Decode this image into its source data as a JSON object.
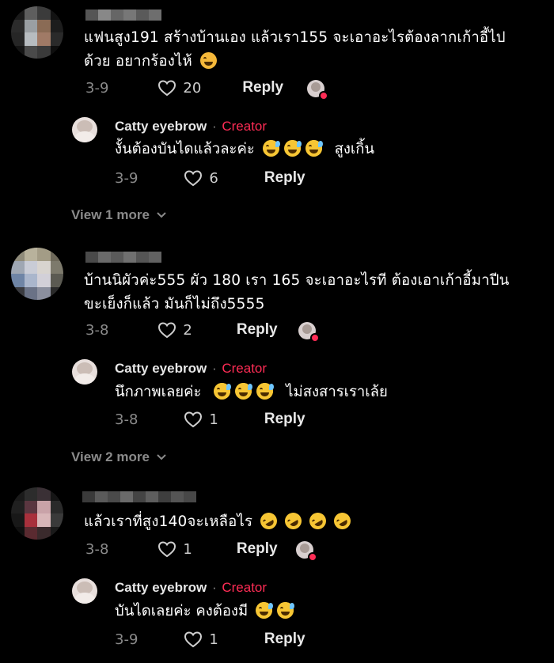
{
  "comments": [
    {
      "text_line1": "แฟนสูง191 สร้างบ้านเอง แล้วเรา155 จะเอาอะไรต้องลากเก้าอี้ไป",
      "text_line2": "ด้วย อยากร้องไห้",
      "date": "3-9",
      "likes": "20",
      "reply_label": "Reply",
      "reply": {
        "author": "Catty eyebrow",
        "separator": "·",
        "badge": "Creator",
        "text": "งั้นต้องบันไดแล้วละค่ะ",
        "text_suffix": "สูงเกิ้น",
        "date": "3-9",
        "likes": "6",
        "reply_label": "Reply"
      },
      "view_more": "View 1 more"
    },
    {
      "text_line1": "บ้านนิผัวค่ะ555 ผัว 180 เรา 165 จะเอาอะไรที ต้องเอาเก้าอี้มาปีน",
      "text_line2": "ขะเย็งก็แล้ว มันก็ไม่ถึง5555",
      "date": "3-8",
      "likes": "2",
      "reply_label": "Reply",
      "reply": {
        "author": "Catty eyebrow",
        "separator": "·",
        "badge": "Creator",
        "text": "นึกภาพเลยค่ะ",
        "text_suffix": "ไม่สงสารเราเล้ย",
        "date": "3-8",
        "likes": "1",
        "reply_label": "Reply"
      },
      "view_more": "View 2 more"
    },
    {
      "text_line1": "แล้วเราที่สูง140จะเหลือไร",
      "date": "3-8",
      "likes": "1",
      "reply_label": "Reply",
      "reply": {
        "author": "Catty eyebrow",
        "separator": "·",
        "badge": "Creator",
        "text": "บันไดเลยค่ะ คงต้องมี",
        "date": "3-9",
        "likes": "1",
        "reply_label": "Reply"
      }
    }
  ],
  "colors": {
    "background": "#000000",
    "creator_badge": "#fe2c55",
    "meta_text": "#8a8a8a"
  },
  "icons": [
    "heart-outline-icon",
    "chevron-down-icon",
    "grinning-sweat-emoji",
    "rolling-laughing-emoji",
    "weary-emoji"
  ]
}
